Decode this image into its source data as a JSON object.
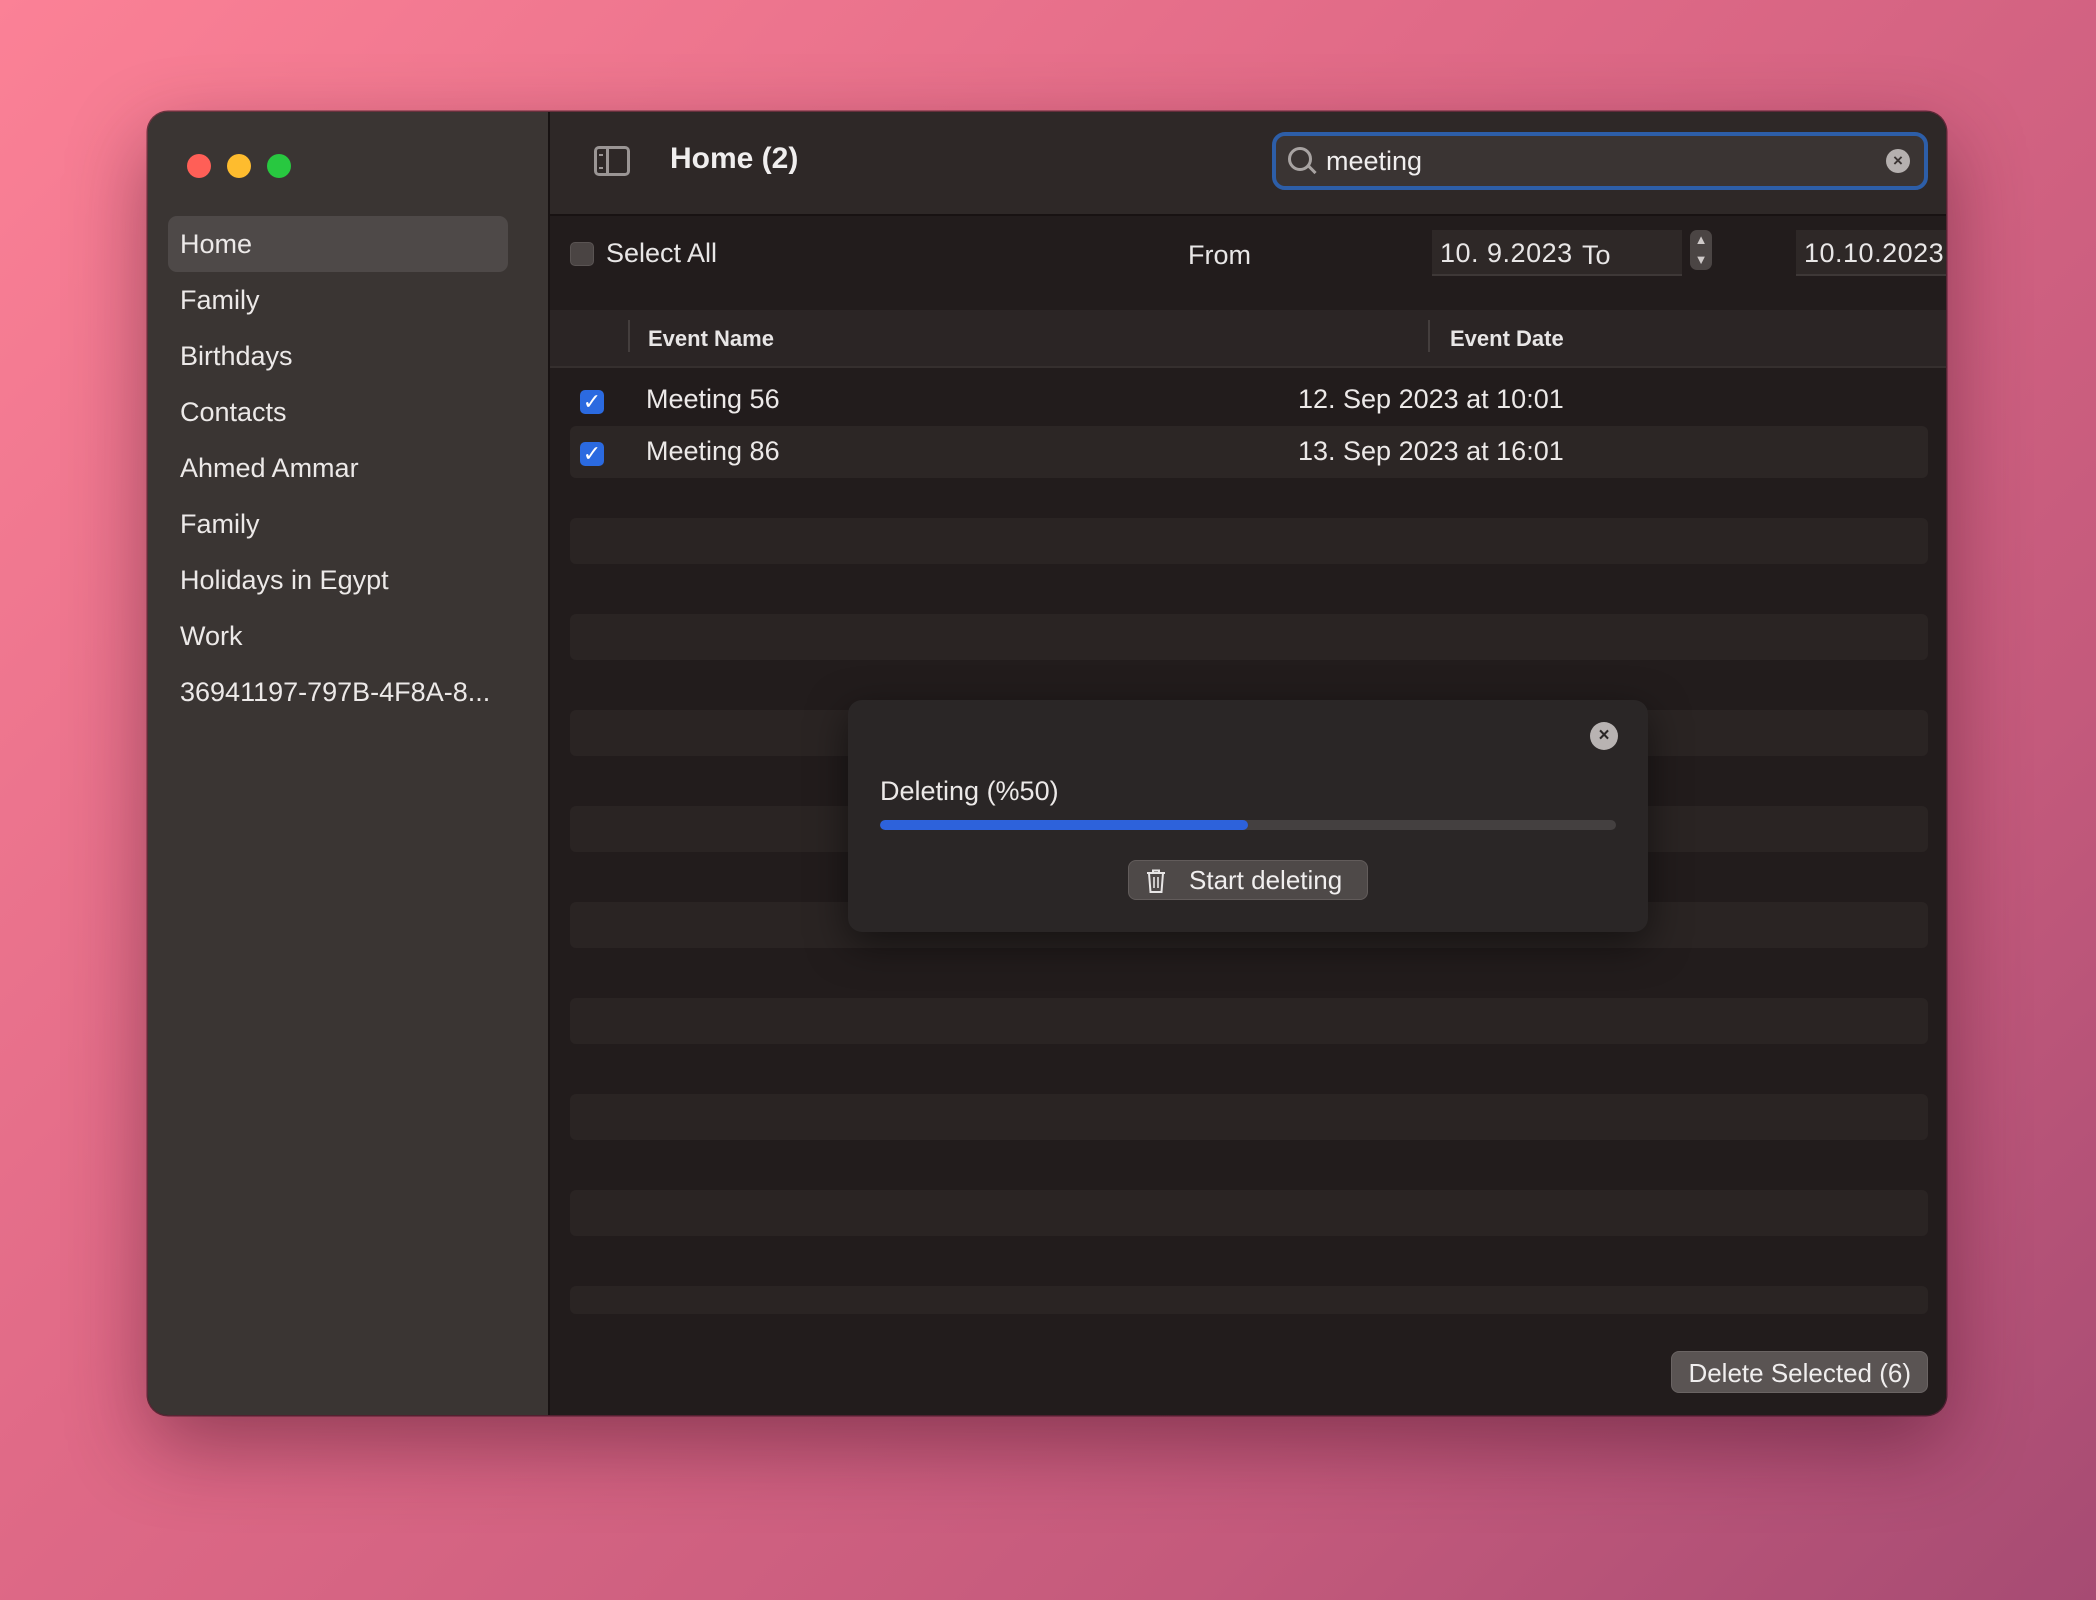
{
  "sidebar": {
    "items": [
      {
        "label": "Home",
        "selected": true
      },
      {
        "label": "Family"
      },
      {
        "label": "Birthdays"
      },
      {
        "label": "Contacts"
      },
      {
        "label": "Ahmed Ammar"
      },
      {
        "label": "Family"
      },
      {
        "label": "Holidays in Egypt"
      },
      {
        "label": "Work"
      },
      {
        "label": "36941197-797B-4F8A-8..."
      }
    ]
  },
  "toolbar": {
    "title": "Home (2)",
    "search_value": "meeting"
  },
  "filters": {
    "select_all_label": "Select All",
    "from_label": "From",
    "from_value": "10.  9.2023",
    "to_label": "To",
    "to_value": "10.10.2023"
  },
  "table": {
    "columns": [
      "Event Name",
      "Event Date"
    ],
    "rows": [
      {
        "name": "Meeting 56",
        "date": "12. Sep 2023 at 10:01",
        "checked": true
      },
      {
        "name": "Meeting 86",
        "date": "13. Sep 2023 at 16:01",
        "checked": true
      }
    ]
  },
  "dialog": {
    "status": "Deleting (%50)",
    "progress_fraction": 0.5,
    "start_label": "Start deleting"
  },
  "footer": {
    "delete_label": "Delete Selected (6)"
  },
  "colors": {
    "accent": "#2d62db",
    "search_focus": "#2d5ea8"
  }
}
